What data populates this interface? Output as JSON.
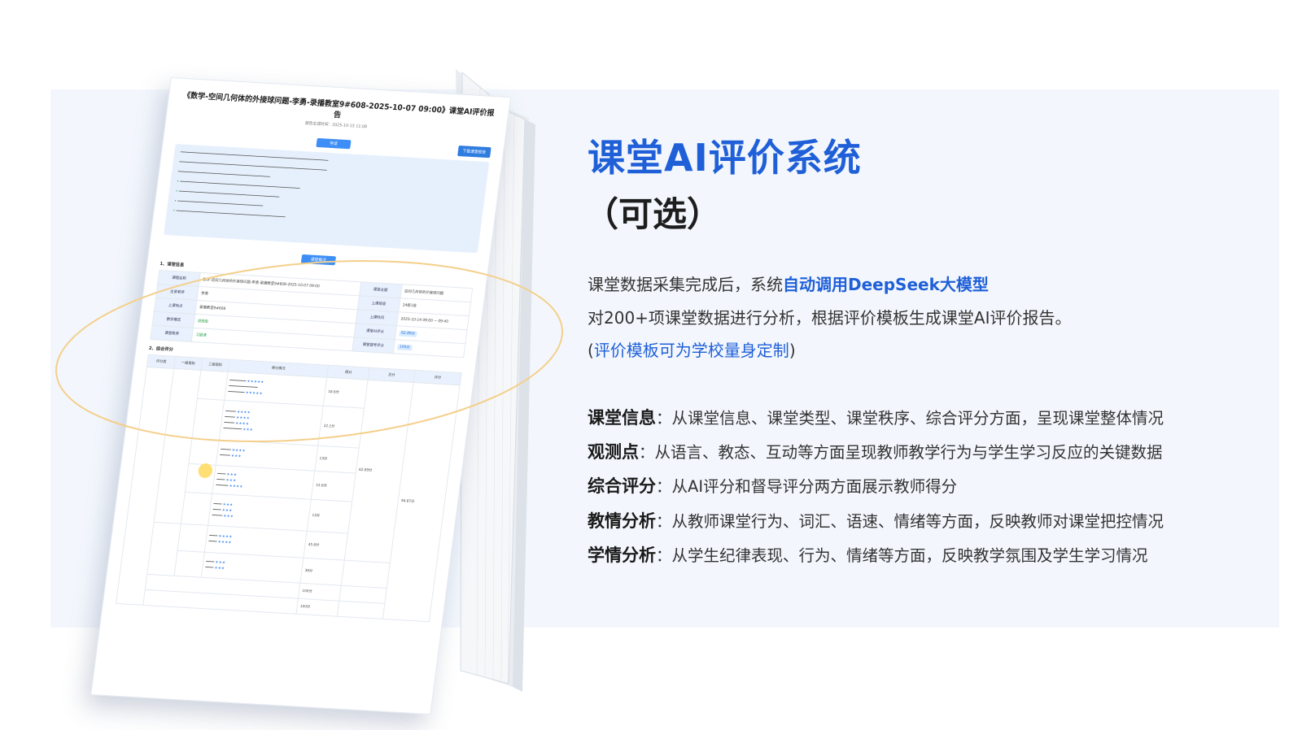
{
  "headline": {
    "title": "课堂AI评价系统",
    "subtitle": "（可选）"
  },
  "description": {
    "line1_prefix": "课堂数据采集完成后，系统",
    "line1_highlight": "自动调用DeepSeek大模型",
    "line2": "对200+项课堂数据进行分析，根据评价模板生成课堂AI评价报告。",
    "line3_open": "(",
    "line3_text": "评价模板可为学校量身定制",
    "line3_close": ")"
  },
  "features": [
    {
      "key": "课堂信息",
      "text": "：从课堂信息、课堂类型、课堂秩序、综合评分方面，呈现课堂整体情况"
    },
    {
      "key": "观测点",
      "text": "：从语言、教态、互动等方面呈现教师教学行为与学生学习反应的关键数据"
    },
    {
      "key": "综合评分",
      "text": "：从AI评分和督导评分两方面展示教师得分"
    },
    {
      "key": "教情分析",
      "text": "：从教师课堂行为、词汇、语速、情绪等方面，反映教师对课堂把控情况"
    },
    {
      "key": "学情分析",
      "text": "：从学生纪律表现、行为、情绪等方面，反映教学氛围及学生学习情况"
    }
  ],
  "report": {
    "title": "《数学-空间几何体的外接球问题-李勇-录播教室9#608-2025-10-07 09:00》课堂AI评价报告",
    "generated": "报告生成时间：2025-10-15 11:08",
    "download": "下载课堂报告",
    "intro_tag": "导读",
    "overview_tag": "课堂概况",
    "section1": "1、课堂信息",
    "section2": "2、综合评分",
    "info": {
      "course_key": "课程名称",
      "course_val": "数学-空间几何体的外接球问题-李勇-录播教室9#608-2025-10-07 09:00",
      "teacher_key": "主讲老师",
      "teacher_val": "李勇",
      "place_key": "上课地点",
      "place_val": "录播教室9#608",
      "mode_key": "教学模式",
      "mode_val": "讲授型",
      "order_key": "课堂秩序",
      "order_val": "习题课",
      "topic_key": "课堂主题",
      "topic_val": "空间几何体的外接球问题",
      "class_key": "上课班级",
      "class_val": "24级1班",
      "time_key": "上课时间",
      "time_val": "2025-10-14 09:00 ~ 09:40",
      "ai_key": "课堂AI评分",
      "ai_val": "62.89分",
      "sup_key": "课堂督导评分",
      "sup_val": "100分"
    },
    "score_headers": [
      "评分类",
      "一级指标",
      "二级指标",
      "得分情况",
      "得分",
      "总分",
      "评分"
    ],
    "scores": [
      "18.6分",
      "22.1分",
      "13分",
      "15.6分",
      "13分",
      "45.8分",
      "38分",
      "100分",
      "100分"
    ],
    "totals": [
      "62.89分",
      "94.87分"
    ]
  }
}
